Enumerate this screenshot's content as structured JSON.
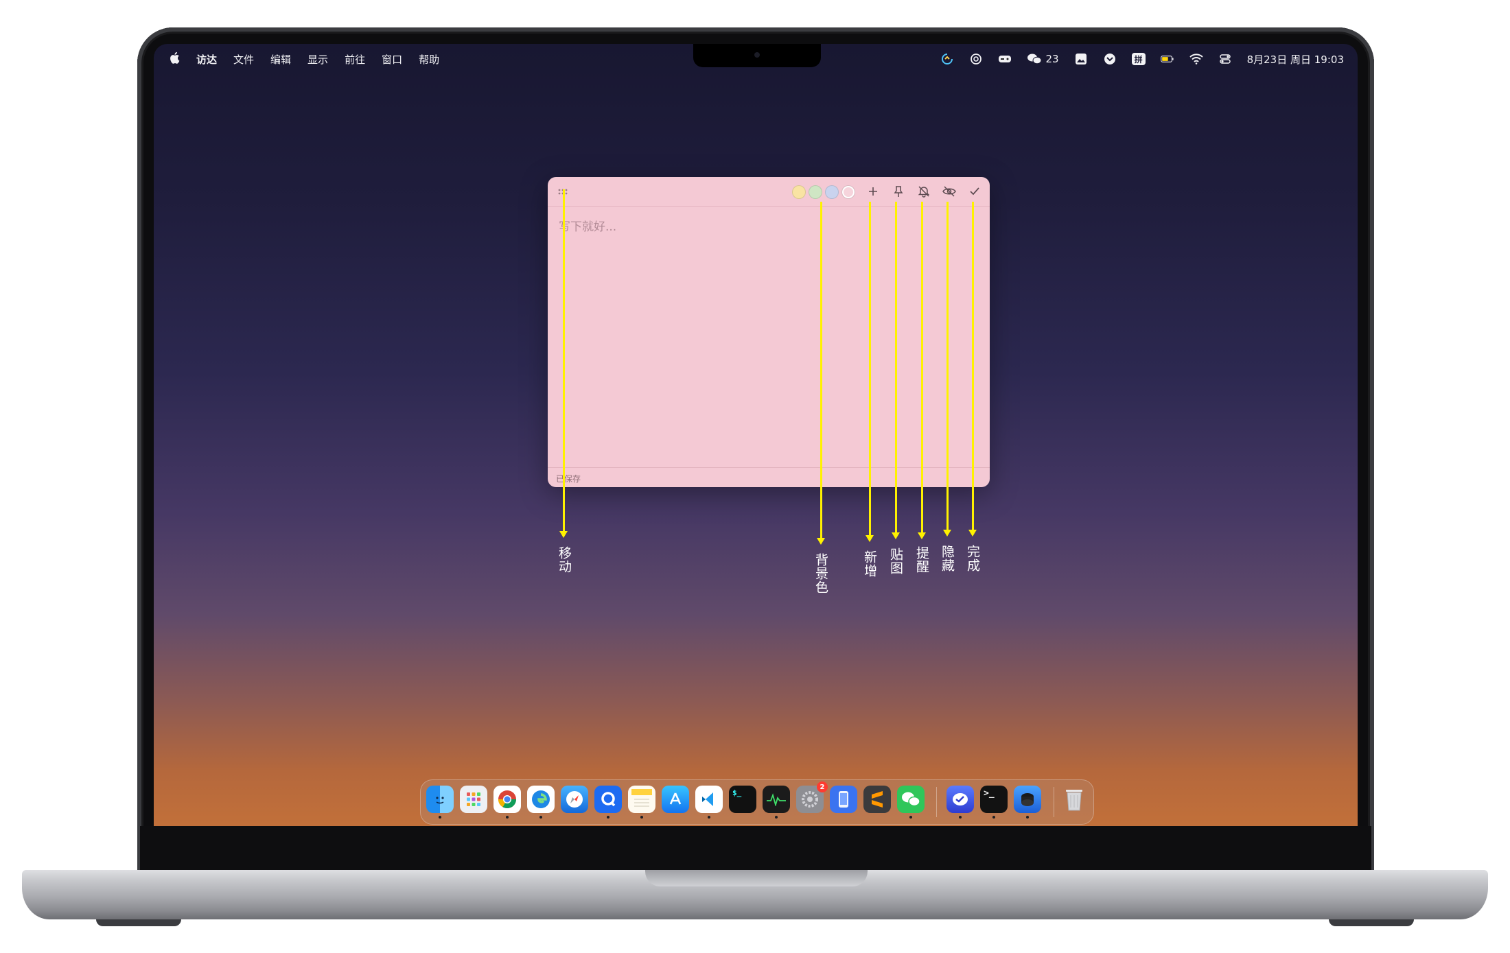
{
  "menubar": {
    "apple": "",
    "app_name": "访达",
    "menus": [
      "文件",
      "编辑",
      "显示",
      "前往",
      "窗口",
      "帮助"
    ],
    "wechat_count": "23",
    "input_method": "拼",
    "datetime": "8月23日 周日 19:03"
  },
  "note": {
    "placeholder": "写下就好...",
    "status": "已保存",
    "colors": [
      "#f9e3a3",
      "#cfe6c4",
      "#c9d3ee",
      "#f6d4dc"
    ],
    "background": "#f4c9d4"
  },
  "annotations": {
    "move": "移动",
    "bg_color": "背景色",
    "add": "新增",
    "pin": "贴图",
    "remind": "提醒",
    "hide": "隐藏",
    "done": "完成",
    "color": "#fff200"
  },
  "dock": {
    "apps": [
      "finder-icon",
      "launchpad-icon",
      "chrome-icon",
      "edge-icon",
      "safari-icon",
      "qq-icon",
      "notes-icon",
      "appstore-icon",
      "vscode-icon",
      "terminal-icon",
      "activity-monitor-icon",
      "system-settings-icon",
      "simulator-icon",
      "sublime-icon",
      "wechat-icon",
      "vpn-icon",
      "terminal2-icon",
      "disk-icon",
      "trash-icon"
    ],
    "settings_badge": "2"
  }
}
